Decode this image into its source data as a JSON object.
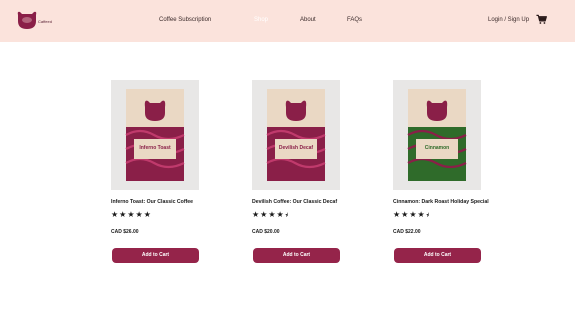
{
  "header": {
    "logo_text": "Caffeed",
    "nav": {
      "subscription": "Coffee Subscription",
      "shop": "Shop",
      "about": "About",
      "faqs": "FAQs"
    },
    "login": "Login / Sign Up",
    "icons": {
      "logo": "cup-logo-icon",
      "cart": "shopping-cart-icon"
    },
    "colors": {
      "background": "#fbe3dc",
      "brand": "#95244a"
    }
  },
  "products": [
    {
      "title": "Inferno Toast: Our Classic Coffee",
      "bag_label": "Inferno Toast",
      "rating": 5,
      "price": "CAD $26.00",
      "button": "Add to Cart",
      "bag_color": "#8a1f48"
    },
    {
      "title": "Devilish Coffee: Our Classic Decaf",
      "bag_label": "Devilish Decaf",
      "rating": 4.5,
      "price": "CAD $20.00",
      "button": "Add to Cart",
      "bag_color": "#8a1f48"
    },
    {
      "title": "Cinnamon: Dark Roast Holiday Special",
      "bag_label": "Cinnamon",
      "rating": 4.5,
      "price": "CAD $22.00",
      "button": "Add to Cart",
      "bag_color": "#2f6b2a"
    }
  ]
}
